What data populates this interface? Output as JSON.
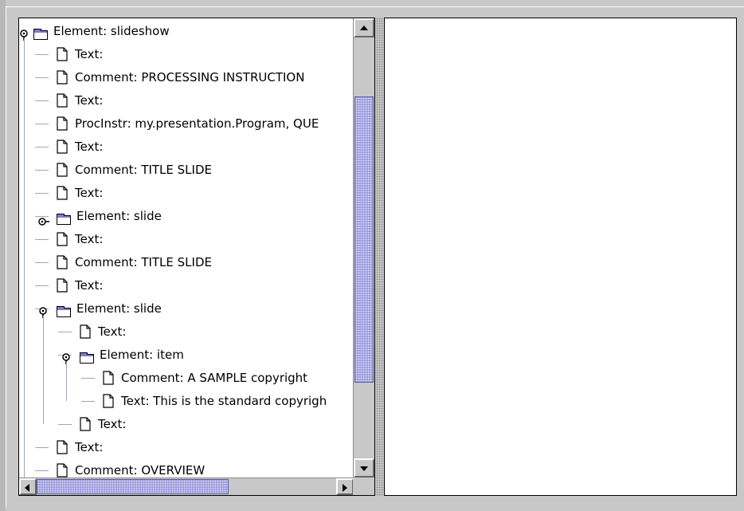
{
  "tree": {
    "nodes": [
      {
        "label": "Element: slideshow",
        "icon": "folder-icon",
        "handle": "expanded",
        "depth": 0
      },
      {
        "label": "Text:",
        "icon": "document-icon",
        "depth": 1
      },
      {
        "label": "Comment: PROCESSING INSTRUCTION",
        "icon": "document-icon",
        "depth": 1
      },
      {
        "label": "Text:",
        "icon": "document-icon",
        "depth": 1
      },
      {
        "label": "ProcInstr: my.presentation.Program, QUE",
        "icon": "document-icon",
        "depth": 1
      },
      {
        "label": "Text:",
        "icon": "document-icon",
        "depth": 1
      },
      {
        "label": "Comment: TITLE SLIDE",
        "icon": "document-icon",
        "depth": 1
      },
      {
        "label": "Text:",
        "icon": "document-icon",
        "depth": 1
      },
      {
        "label": "Element: slide",
        "icon": "folder-icon",
        "handle": "collapsed",
        "depth": 1
      },
      {
        "label": "Text:",
        "icon": "document-icon",
        "depth": 1
      },
      {
        "label": "Comment: TITLE SLIDE",
        "icon": "document-icon",
        "depth": 1
      },
      {
        "label": "Text:",
        "icon": "document-icon",
        "depth": 1
      },
      {
        "label": "Element: slide",
        "icon": "folder-icon",
        "handle": "expanded",
        "depth": 1
      },
      {
        "label": "Text:",
        "icon": "document-icon",
        "depth": 2
      },
      {
        "label": "Element: item",
        "icon": "folder-icon",
        "handle": "expanded",
        "depth": 2
      },
      {
        "label": "Comment: A SAMPLE copyright",
        "icon": "document-icon",
        "depth": 3
      },
      {
        "label": "Text: This is the standard copyrigh",
        "icon": "document-icon",
        "depth": 3
      },
      {
        "label": "Text:",
        "icon": "document-icon",
        "depth": 2
      },
      {
        "label": "Text:",
        "icon": "document-icon",
        "depth": 1
      },
      {
        "label": "Comment: OVERVIEW",
        "icon": "document-icon",
        "depth": 1
      }
    ]
  },
  "scroll": {
    "vertical_position": 0.14,
    "vertical_visible_fraction": 0.68,
    "horizontal_position": 0.0,
    "horizontal_visible_fraction": 0.64
  },
  "colors": {
    "thumb": "#9b9bdb",
    "tree_line": "#9ea3c8",
    "folder": "#7c7cc8"
  }
}
